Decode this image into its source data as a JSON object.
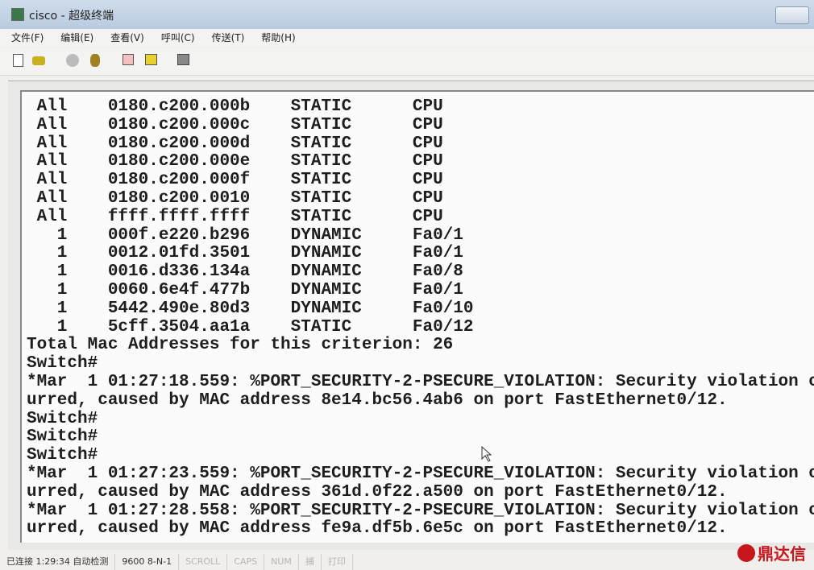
{
  "window": {
    "title": "cisco - 超级终端"
  },
  "menu": [
    "文件(F)",
    "编辑(E)",
    "查看(V)",
    "呼叫(C)",
    "传送(T)",
    "帮助(H)"
  ],
  "toolbar": [
    "new-icon",
    "open-icon",
    "disconnect-icon",
    "call-icon",
    "send-icon",
    "receive-icon",
    "properties-icon"
  ],
  "terminal": {
    "lines": [
      " All    0180.c200.000b    STATIC      CPU",
      " All    0180.c200.000c    STATIC      CPU",
      " All    0180.c200.000d    STATIC      CPU",
      " All    0180.c200.000e    STATIC      CPU",
      " All    0180.c200.000f    STATIC      CPU",
      " All    0180.c200.0010    STATIC      CPU",
      " All    ffff.ffff.ffff    STATIC      CPU",
      "   1    000f.e220.b296    DYNAMIC     Fa0/1",
      "   1    0012.01fd.3501    DYNAMIC     Fa0/1",
      "   1    0016.d336.134a    DYNAMIC     Fa0/8",
      "   1    0060.6e4f.477b    DYNAMIC     Fa0/1",
      "   1    5442.490e.80d3    DYNAMIC     Fa0/10",
      "   1    5cff.3504.aa1a    STATIC      Fa0/12",
      "Total Mac Addresses for this criterion: 26",
      "Switch#",
      "*Mar  1 01:27:18.559: %PORT_SECURITY-2-PSECURE_VIOLATION: Security violation occ",
      "urred, caused by MAC address 8e14.bc56.4ab6 on port FastEthernet0/12.",
      "Switch#",
      "Switch#",
      "Switch#",
      "*Mar  1 01:27:23.559: %PORT_SECURITY-2-PSECURE_VIOLATION: Security violation occ",
      "urred, caused by MAC address 361d.0f22.a500 on port FastEthernet0/12.",
      "*Mar  1 01:27:28.558: %PORT_SECURITY-2-PSECURE_VIOLATION: Security violation occ",
      "urred, caused by MAC address fe9a.df5b.6e5c on port FastEthernet0/12."
    ]
  },
  "status": {
    "connection": "已连接 1:29:34 自动检测",
    "settings": "9600 8-N-1",
    "scroll": "SCROLL",
    "caps": "CAPS",
    "num": "NUM",
    "capture": "捕",
    "print": "打印"
  },
  "watermark": "鼎达信",
  "colors": {
    "titlebar": "#c4d4e6",
    "terminal_bg": "#fbfbfb",
    "logo": "#c8161d"
  }
}
